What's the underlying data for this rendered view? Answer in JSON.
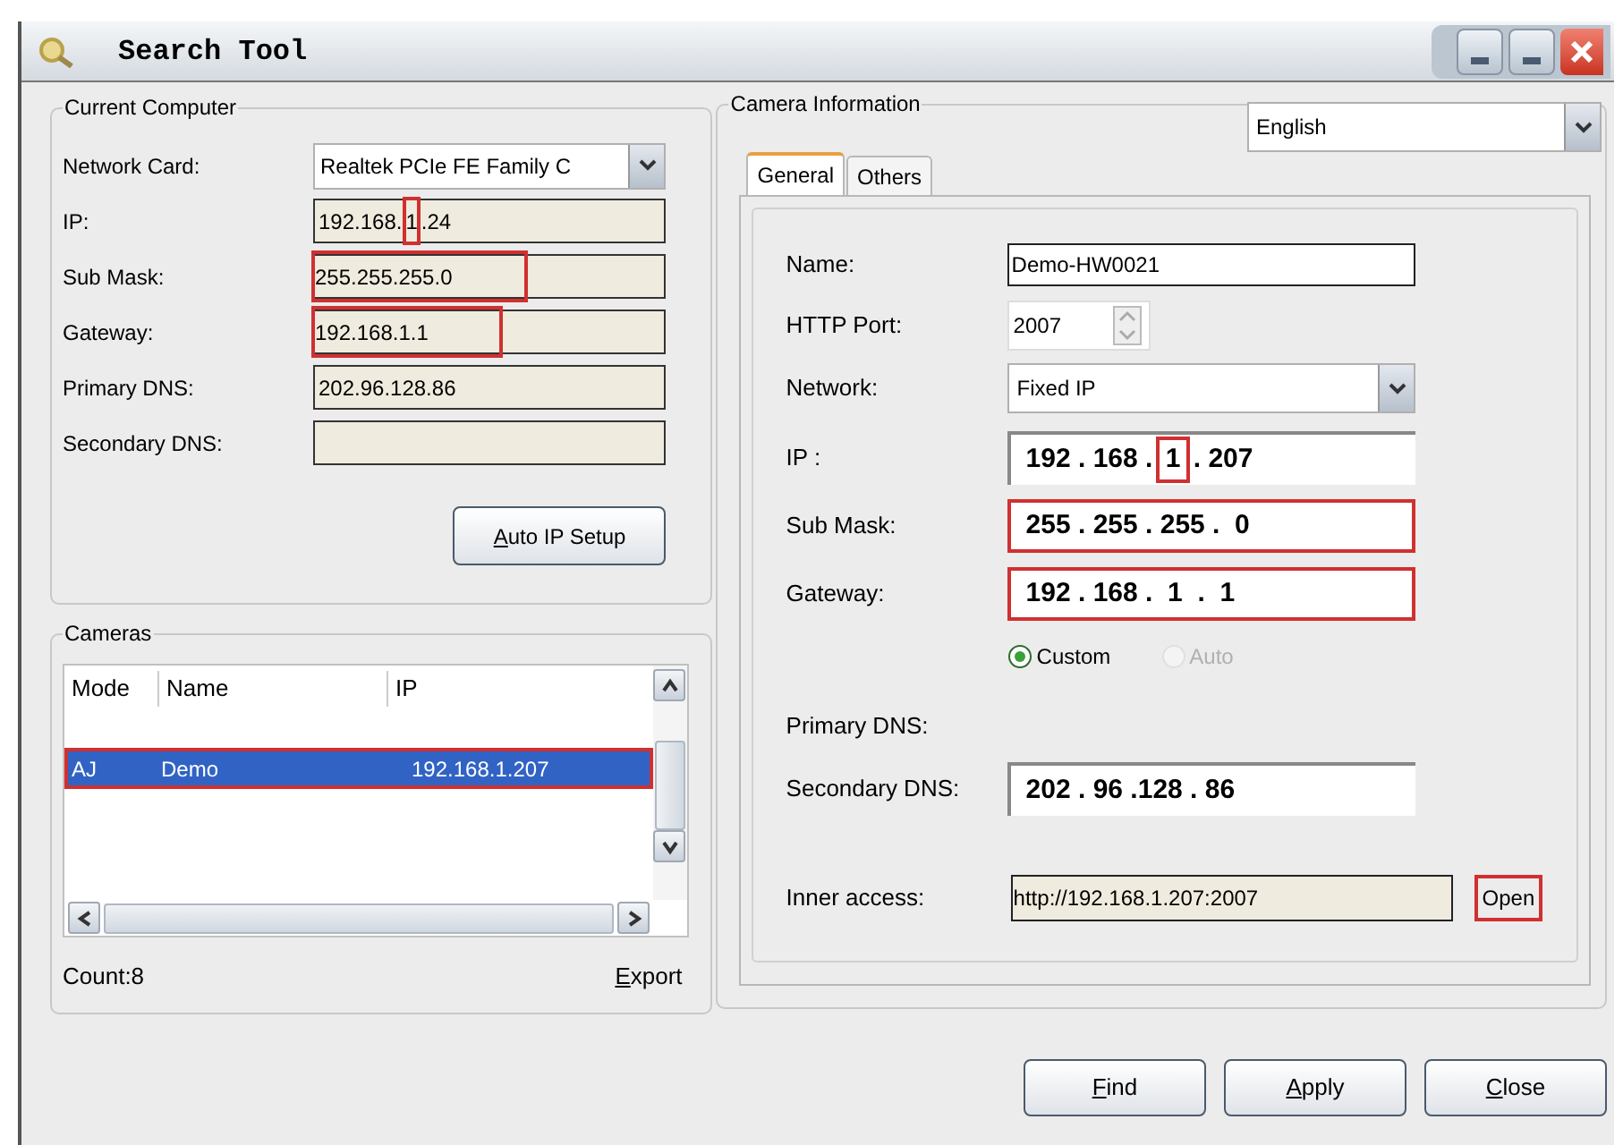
{
  "window": {
    "title": "Search Tool"
  },
  "current_computer": {
    "title": "Current Computer",
    "fields": [
      {
        "kind": "select",
        "label": "Network Card:",
        "value": "Realtek PCIe FE Family C"
      },
      {
        "kind": "text",
        "label": "IP:",
        "segments": [
          {
            "text": "192.168.",
            "highlighted": false
          },
          {
            "text": "1",
            "highlighted": true
          },
          {
            "text": ".24",
            "highlighted": false
          }
        ]
      },
      {
        "kind": "text",
        "label": "Sub Mask:",
        "segments": [
          {
            "text": "255.255.255.0",
            "highlighted": true
          }
        ]
      },
      {
        "kind": "text",
        "label": "Gateway:",
        "segments": [
          {
            "text": "192.168.1.1",
            "highlighted": true
          }
        ]
      },
      {
        "kind": "text",
        "label": "Primary DNS:",
        "segments": [
          {
            "text": "202.96.128.86",
            "highlighted": false
          }
        ]
      },
      {
        "kind": "text",
        "label": "Secondary DNS:"
      }
    ],
    "button": "Auto IP Setup"
  },
  "cameras": {
    "title": "Cameras",
    "columns": [
      "Mode",
      "Name",
      "IP"
    ],
    "rows": [
      {
        "mode": "AJ",
        "name": "Demo",
        "ip": "192.168.1.207",
        "selected": true,
        "highlighted": true
      }
    ],
    "count": "Count:8",
    "export": "Export"
  },
  "camera_information": {
    "title": "Camera Information",
    "language": "English",
    "tabs": [
      {
        "label": "General",
        "selected": true
      },
      {
        "label": "Others",
        "selected": false
      }
    ],
    "name": {
      "label": "Name:",
      "value": "Demo-HW0021"
    },
    "http_port": {
      "label": "HTTP Port:",
      "value": "2007"
    },
    "network": {
      "label": "Network:",
      "value": "Fixed IP"
    },
    "address_fields": [
      {
        "label": "IP :",
        "highlighted": false,
        "segments": [
          {
            "text": "192 . 168 . ",
            "highlighted": false
          },
          {
            "text": "1",
            "highlighted": true
          },
          {
            "text": " . 207",
            "highlighted": false
          }
        ]
      },
      {
        "label": "Sub Mask:",
        "highlighted": true,
        "segments": [
          {
            "text": "255 . 255 . 255 .  0",
            "highlighted": false
          }
        ]
      },
      {
        "label": "Gateway:",
        "highlighted": true,
        "segments": [
          {
            "text": "192 . 168 .  1  .  1",
            "highlighted": false
          }
        ]
      }
    ],
    "modes": [
      {
        "label": "Custom",
        "selected": true,
        "disabled": false
      },
      {
        "label": "Auto",
        "selected": false,
        "disabled": true
      }
    ],
    "primary_dns": {
      "label": "Primary DNS:"
    },
    "secondary_dns": {
      "label": "Secondary DNS:",
      "value": "202 . 96 .128 . 86"
    },
    "inner_access": {
      "label": "Inner access:",
      "value": "http://192.168.1.207:2007",
      "button": "Open",
      "button_highlighted": true
    }
  },
  "buttons": [
    "Find",
    "Apply",
    "Close"
  ]
}
